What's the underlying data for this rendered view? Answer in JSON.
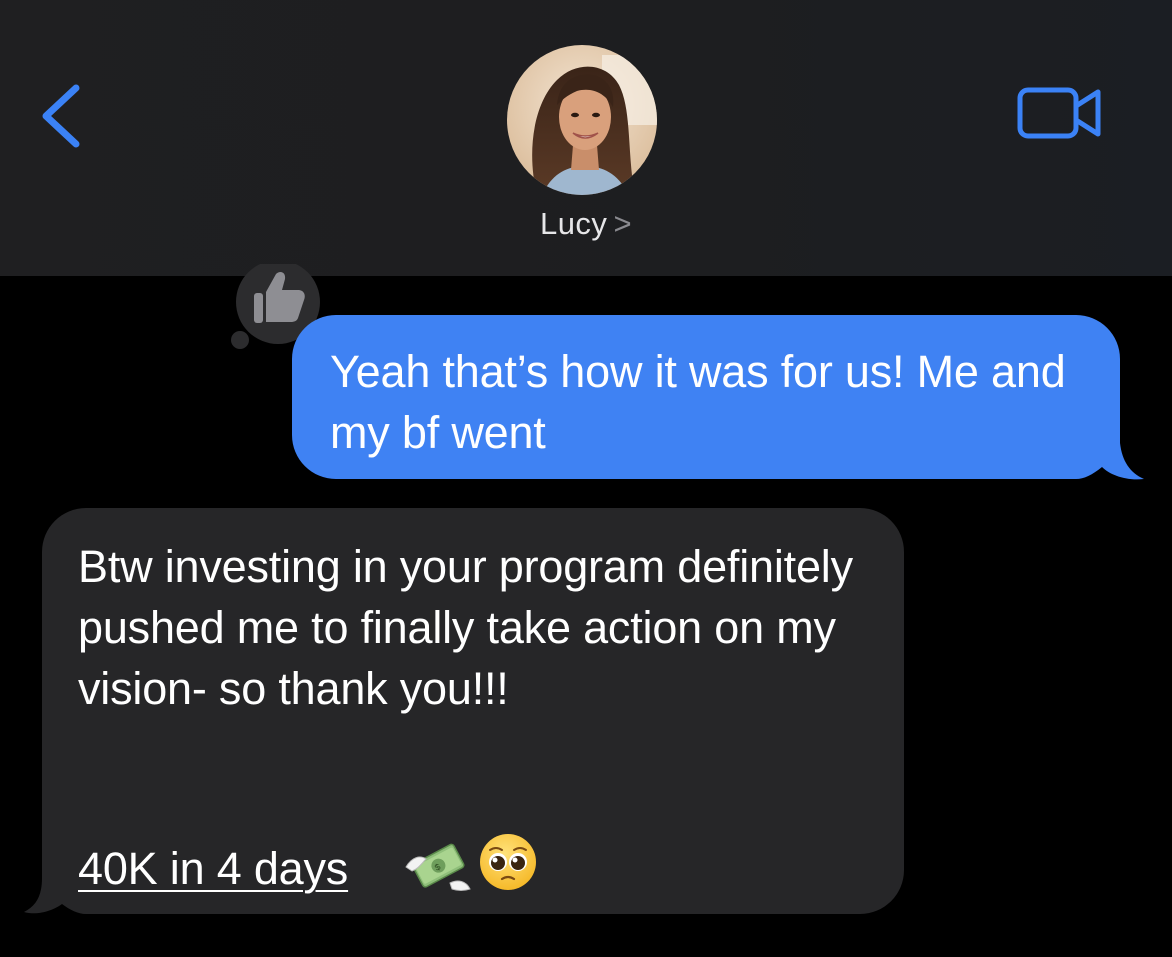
{
  "header": {
    "contact_name": "Lucy",
    "contact_chevron": ">",
    "back_icon": "chevron-left-icon",
    "video_icon": "video-camera-icon",
    "accent_color": "#3b82f6"
  },
  "messages": [
    {
      "direction": "sent",
      "text": "Yeah that’s how it was for us! Me and my bf went",
      "tapback": "thumbs-up-icon",
      "bubble_color": "#3f82f3"
    },
    {
      "direction": "received",
      "text": "Btw investing in your program definitely pushed me to finally take action on my vision- so thank you!!!",
      "link_text": "40K in 4 days",
      "emojis": [
        "money-with-wings-emoji",
        "pleading-face-emoji"
      ],
      "bubble_color": "#262628"
    }
  ]
}
